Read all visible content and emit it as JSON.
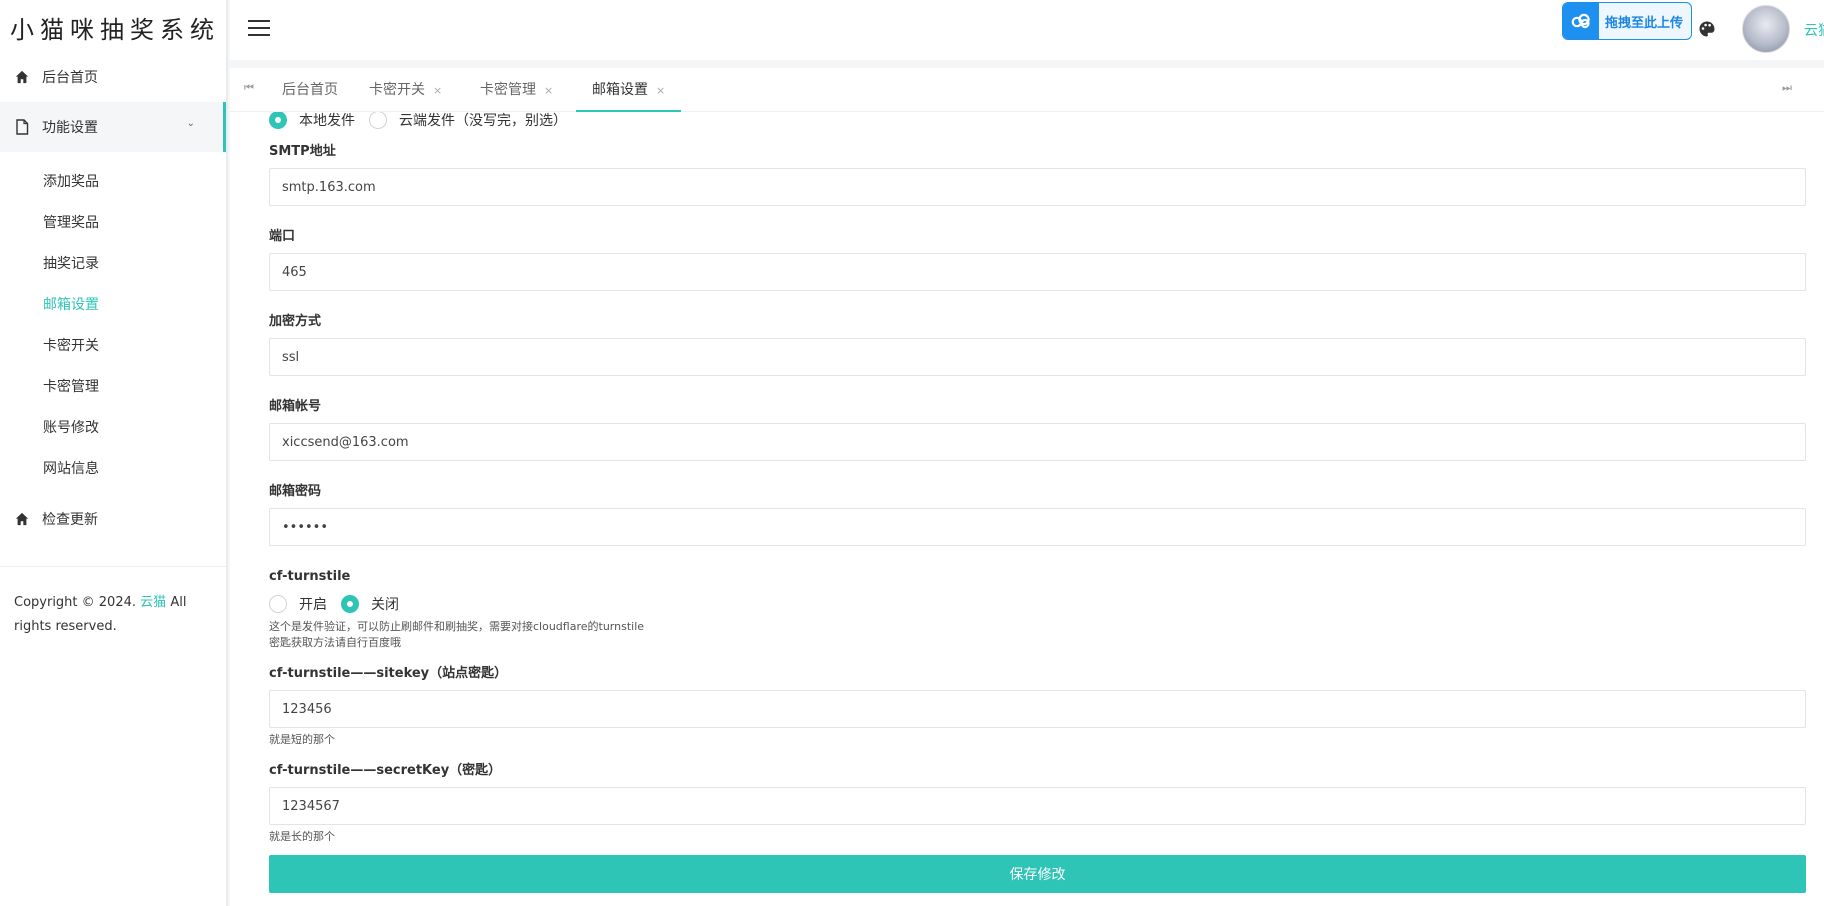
{
  "brand": "小猫咪抽奖系统",
  "sidebar": {
    "home": "后台首页",
    "features": "功能设置",
    "sub_items": [
      "添加奖品",
      "管理奖品",
      "抽奖记录",
      "邮箱设置",
      "卡密开关",
      "卡密管理",
      "账号修改",
      "网站信息"
    ],
    "active_sub": "邮箱设置",
    "check_update": "检查更新",
    "copyright_prefix": "Copyright © 2024.",
    "copyright_link": "云猫",
    "copyright_suffix": "All rights reserved."
  },
  "header": {
    "upload_label": "拖拽至此上传",
    "username": "云猫"
  },
  "tabs": [
    {
      "label": "后台首页",
      "closable": false
    },
    {
      "label": "卡密开关",
      "closable": true
    },
    {
      "label": "卡密管理",
      "closable": true
    },
    {
      "label": "邮箱设置",
      "closable": true,
      "active": true
    }
  ],
  "form": {
    "send_mode": {
      "options": [
        "本地发件",
        "云端发件（没写完，别选）"
      ],
      "selected": "本地发件"
    },
    "smtp": {
      "label": "SMTP地址",
      "value": "smtp.163.com"
    },
    "port": {
      "label": "端口",
      "value": "465"
    },
    "encryption": {
      "label": "加密方式",
      "value": "ssl"
    },
    "account": {
      "label": "邮箱帐号",
      "value": "xiccsend@163.com"
    },
    "password": {
      "label": "邮箱密码",
      "value": "••••••"
    },
    "turnstile": {
      "label": "cf-turnstile",
      "options": [
        "开启",
        "关闭"
      ],
      "selected": "关闭",
      "hint_1": "这个是发件验证，可以防止刷邮件和刷抽奖，需要对接cloudflare的turnstile",
      "hint_2": "密匙获取方法请自行百度哦"
    },
    "sitekey": {
      "label": "cf-turnstile——sitekey（站点密匙）",
      "value": "123456",
      "hint": "就是短的那个"
    },
    "secretkey": {
      "label": "cf-turnstile——secretKey（密匙）",
      "value": "1234567",
      "hint": "就是长的那个"
    },
    "save_label": "保存修改"
  },
  "colors": {
    "accent": "#2ec4b6",
    "upload_blue": "#1e90ef"
  }
}
